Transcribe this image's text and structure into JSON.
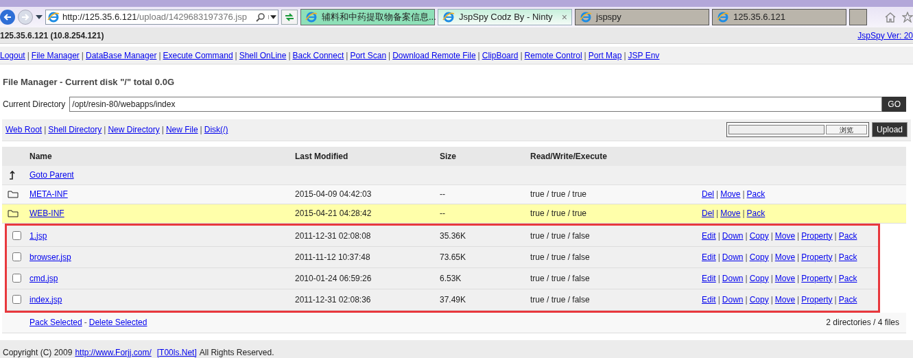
{
  "browser": {
    "address": {
      "host": "http://125.35.6.121",
      "path": "/upload/1429683197376.jsp"
    },
    "tabs": [
      {
        "label": "辅料和中药提取物备案信息...",
        "selected": false
      },
      {
        "label": "JspSpy Codz By - Ninty",
        "selected": true,
        "close": "×"
      },
      {
        "label": "jspspy",
        "selected": false
      },
      {
        "label": "125.35.6.121",
        "selected": false
      }
    ]
  },
  "host_bar": {
    "host": "125.35.6.121 (10.8.254.121)",
    "version_link": "JspSpy Ver: 20"
  },
  "nav": {
    "separator": "|",
    "links": [
      "Logout",
      "File Manager",
      "DataBase Manager",
      "Execute Command",
      "Shell OnLine",
      "Back Connect",
      "Port Scan",
      "Download Remote File",
      "ClipBoard",
      "Remote Control",
      "Port Map",
      "JSP Env"
    ]
  },
  "title": "File Manager - Current disk \"/\" total 0.0G",
  "directory": {
    "label": "Current Directory",
    "value": "/opt/resin-80/webapps/index",
    "button": "GO"
  },
  "toolbar": {
    "separator": "|",
    "links": [
      "Web Root",
      "Shell Directory",
      "New Directory",
      "New File",
      "Disk(/)"
    ],
    "browse_button": "浏览",
    "upload_button": "Upload"
  },
  "table": {
    "action_separator": "|",
    "footer_separator": "-",
    "columns": [
      "Name",
      "Last Modified",
      "Size",
      "Read/Write/Execute"
    ],
    "parent": "Goto Parent",
    "rows": [
      {
        "kind": "dir",
        "name": "META-INF",
        "modified": "2015-04-09 04:42:03",
        "size": "--",
        "rwx": "true / true / true",
        "actions": [
          "Del",
          "Move",
          "Pack"
        ],
        "hovered": false,
        "highlighted": false
      },
      {
        "kind": "dir",
        "name": "WEB-INF",
        "modified": "2015-04-21 04:28:42",
        "size": "--",
        "rwx": "true / true / true",
        "actions": [
          "Del",
          "Move",
          "Pack"
        ],
        "hovered": true,
        "highlighted": false
      },
      {
        "kind": "file",
        "name": "1.jsp",
        "modified": "2011-12-31 02:08:08",
        "size": "35.36K",
        "rwx": "true / true / false",
        "actions": [
          "Edit",
          "Down",
          "Copy",
          "Move",
          "Property",
          "Pack"
        ],
        "hovered": false,
        "highlighted": true,
        "checked": false
      },
      {
        "kind": "file",
        "name": "browser.jsp",
        "modified": "2011-11-12 10:37:48",
        "size": "73.65K",
        "rwx": "true / true / false",
        "actions": [
          "Edit",
          "Down",
          "Copy",
          "Move",
          "Property",
          "Pack"
        ],
        "hovered": false,
        "highlighted": true,
        "checked": false
      },
      {
        "kind": "file",
        "name": "cmd.jsp",
        "modified": "2010-01-24 06:59:26",
        "size": "6.53K",
        "rwx": "true / true / false",
        "actions": [
          "Edit",
          "Down",
          "Copy",
          "Move",
          "Property",
          "Pack"
        ],
        "hovered": false,
        "highlighted": true,
        "checked": false
      },
      {
        "kind": "file",
        "name": "index.jsp",
        "modified": "2011-12-31 02:08:36",
        "size": "37.49K",
        "rwx": "true / true / false",
        "actions": [
          "Edit",
          "Down",
          "Copy",
          "Move",
          "Property",
          "Pack"
        ],
        "hovered": false,
        "highlighted": true,
        "checked": false
      }
    ],
    "footer_links": [
      "Pack Selected",
      "Delete Selected"
    ],
    "summary": "2 directories / 4 files"
  },
  "copyright": {
    "before": "Copyright (C) 2009",
    "link": "http://www.Forjj.com/",
    "link2": "[T00ls.Net]",
    "after": "All Rights Reserved."
  }
}
